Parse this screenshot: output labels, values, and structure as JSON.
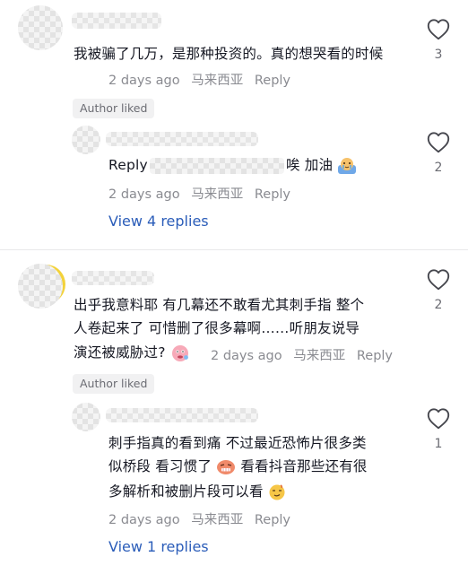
{
  "comments": [
    {
      "text": "我被骗了几万，是那种投资的。真的想哭看的时候",
      "time": "2 days ago",
      "region": "马来西亚",
      "reply_label": "Reply",
      "badge": "Author liked",
      "likes": "3",
      "reply": {
        "prefix": "Reply",
        "text": "唉 加油",
        "time": "2 days ago",
        "region": "马来西亚",
        "reply_label": "Reply",
        "likes": "2"
      },
      "view_replies": "View 4 replies"
    },
    {
      "text_line1": "出乎我意料耶 有几幕还不敢看尤其刺手指 整个",
      "text_line2": "人卷起来了 可惜删了很多幕啊……听朋友说导",
      "text_line3": "演还被威胁过?",
      "time": "2 days ago",
      "region": "马来西亚",
      "reply_label": "Reply",
      "badge": "Author liked",
      "likes": "2",
      "reply": {
        "text_line1": "刺手指真的看到痛 不过最近恐怖片很多类",
        "text_line2a": "似桥段 看习惯了",
        "text_line2b": "看看抖音那些还有很",
        "text_line3": "多解析和被删片段可以看",
        "time": "2 days ago",
        "region": "马来西亚",
        "reply_label": "Reply",
        "likes": "1"
      },
      "view_replies": "View 1 replies"
    }
  ],
  "icons": {
    "like": "heart-outline-icon",
    "emoji_cheer": "crying-cheer-emoji-icon",
    "emoji_thinking": "thinking-face-emoji-icon",
    "emoji_grimace": "grimace-emoji-icon",
    "emoji_smirk": "smirk-face-emoji-icon"
  },
  "colors": {
    "link": "#2b5db9",
    "meta": "#8a8b91",
    "text": "#161823",
    "badge_bg": "#f1f1f2"
  }
}
